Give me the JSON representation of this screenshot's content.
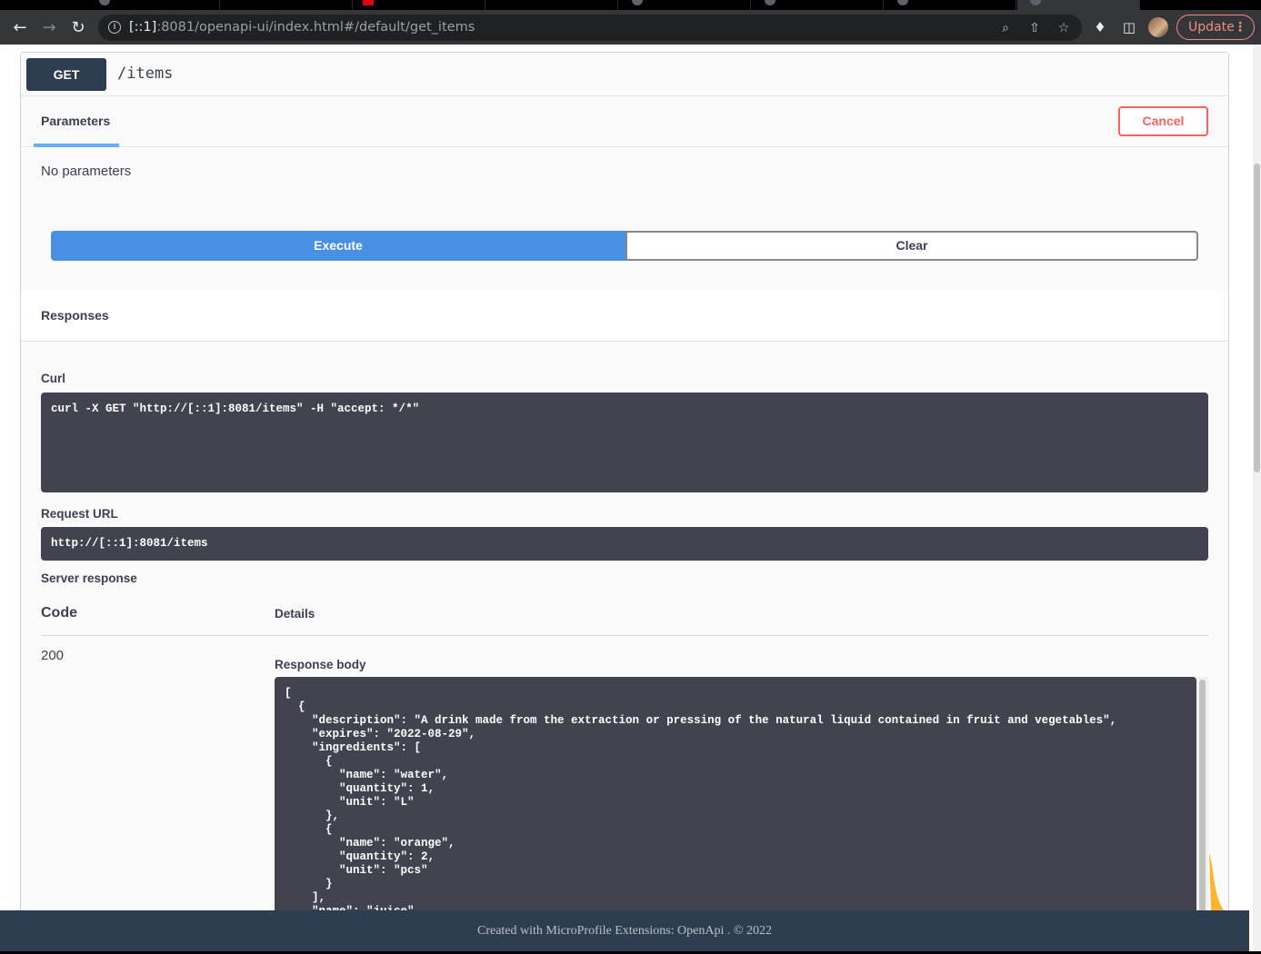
{
  "browser": {
    "url_host": "[::1]",
    "url_rest": ":8081/openapi-ui/index.html#/default/get_items",
    "update_label": "Update",
    "back_icon": "arrow-left-icon",
    "forward_icon": "arrow-right-icon",
    "reload_icon": "reload-icon"
  },
  "operation": {
    "method": "GET",
    "path": "/items"
  },
  "tabs": {
    "parameters_label": "Parameters",
    "cancel_label": "Cancel"
  },
  "params": {
    "empty_text": "No parameters"
  },
  "actions": {
    "execute_label": "Execute",
    "clear_label": "Clear"
  },
  "responses": {
    "title": "Responses",
    "curl_label": "Curl",
    "curl_command": "curl -X GET \"http://[::1]:8081/items\" -H \"accept: */*\"",
    "request_url_label": "Request URL",
    "request_url": "http://[::1]:8081/items",
    "server_response_label": "Server response",
    "code_header": "Code",
    "details_header": "Details",
    "status_code": "200",
    "response_body_label": "Response body",
    "response_body": "[\n  {\n    \"description\": \"A drink made from the extraction or pressing of the natural liquid contained in fruit and vegetables\",\n    \"expires\": \"2022-08-29\",\n    \"ingredients\": [\n      {\n        \"name\": \"water\",\n        \"quantity\": 1,\n        \"unit\": \"L\"\n      },\n      {\n        \"name\": \"orange\",\n        \"quantity\": 2,\n        \"unit\": \"pcs\"\n      }\n    ],\n    \"name\": \"juice\","
  },
  "footer": {
    "text": "Created with MicroProfile Extensions: OpenApi . © 2022"
  },
  "colors": {
    "method_bg": "#2e3e50",
    "execute_bg": "#4990e2",
    "cancel": "#ff6060",
    "code_bg": "#41444e",
    "tab_underline": "#61affe"
  }
}
